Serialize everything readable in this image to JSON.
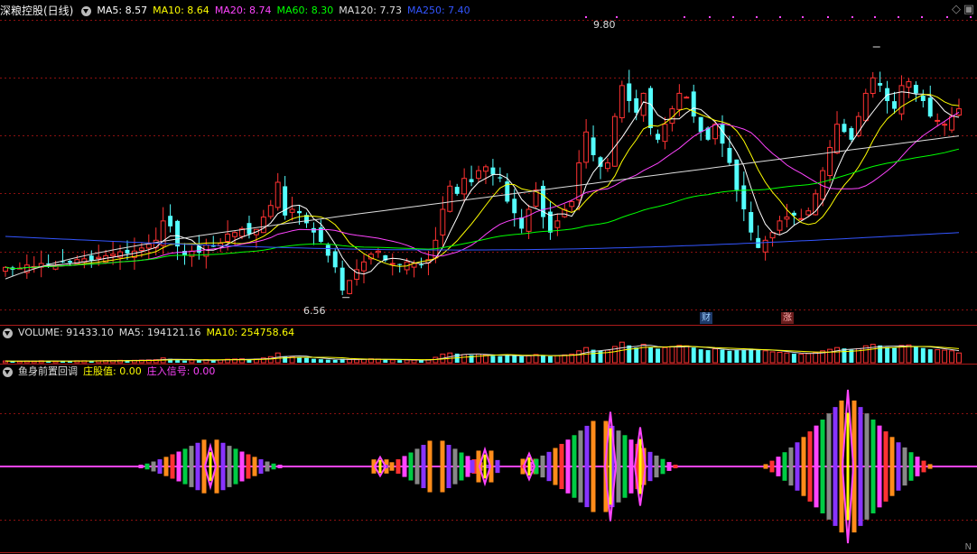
{
  "header": {
    "title": "深粮控股(日线)",
    "ma": [
      {
        "label": "MA5: 8.57",
        "color": "#ffffff"
      },
      {
        "label": "MA10: 8.64",
        "color": "#ffff00"
      },
      {
        "label": "MA20: 8.74",
        "color": "#ff44ff"
      },
      {
        "label": "MA60: 8.30",
        "color": "#00ff00"
      },
      {
        "label": "MA120: 7.73",
        "color": "#dddddd"
      },
      {
        "label": "MA250: 7.40",
        "color": "#3355ff"
      }
    ]
  },
  "volume_header": {
    "label": "VOLUME: 91433.10",
    "ma5": "MA5: 194121.16",
    "ma10": "MA10: 254758.64"
  },
  "indicator_header": {
    "name": "鱼身前置回调",
    "v1": "庄股值: 0.00",
    "v2": "庄入信号: 0.00"
  },
  "annotations": {
    "high": "9.80",
    "low": "6.56",
    "flag1": "财",
    "flag2": "涨",
    "corner": "N"
  },
  "colors": {
    "up": "#ff3232",
    "down": "#54ffff",
    "ma5": "#ffffff",
    "ma10": "#ffff00",
    "ma20": "#ff44ff",
    "ma60": "#00ff00",
    "ma120": "#dddddd",
    "ma250": "#3355ff",
    "grid": "#8a1010"
  },
  "chart_data": [
    {
      "type": "candlestick",
      "ylim": [
        6.3,
        10.15
      ],
      "high_marker": 9.8,
      "low_marker": 6.56,
      "close": [
        6.95,
        6.92,
        6.94,
        6.98,
        6.96,
        7.0,
        6.99,
        6.97,
        7.02,
        7.01,
        7.05,
        7.06,
        7.04,
        7.08,
        7.1,
        7.12,
        7.15,
        7.13,
        7.16,
        7.2,
        7.25,
        7.3,
        7.55,
        7.48,
        7.22,
        7.1,
        7.16,
        7.14,
        7.24,
        7.22,
        7.26,
        7.38,
        7.4,
        7.45,
        7.38,
        7.44,
        7.6,
        7.75,
        8.05,
        7.62,
        7.7,
        7.65,
        7.52,
        7.4,
        7.28,
        7.1,
        6.95,
        6.65,
        6.78,
        6.92,
        7.02,
        7.12,
        7.16,
        7.04,
        7.0,
        6.98,
        7.02,
        7.0,
        6.98,
        7.05,
        7.3,
        7.7,
        8.0,
        7.9,
        8.1,
        8.05,
        8.2,
        8.25,
        8.15,
        8.1,
        7.8,
        7.65,
        7.45,
        7.7,
        7.95,
        7.6,
        7.4,
        7.55,
        7.7,
        7.8,
        8.3,
        8.7,
        8.4,
        8.25,
        8.3,
        8.9,
        9.3,
        9.1,
        8.95,
        9.2,
        8.75,
        8.6,
        8.8,
        9.0,
        9.2,
        9.15,
        8.9,
        8.7,
        8.6,
        8.8,
        8.55,
        8.3,
        7.95,
        7.7,
        7.4,
        7.2,
        7.3,
        7.4,
        7.55,
        7.6,
        7.62,
        7.58,
        7.68,
        7.9,
        8.2,
        8.5,
        8.8,
        8.7,
        8.6,
        8.9,
        9.2,
        9.4,
        9.3,
        9.1,
        9.0,
        9.3,
        9.35,
        9.2,
        9.1,
        8.9,
        8.85,
        8.8,
        8.9,
        9.0
      ],
      "volume": [
        0.08,
        0.07,
        0.07,
        0.08,
        0.07,
        0.09,
        0.08,
        0.07,
        0.08,
        0.08,
        0.09,
        0.09,
        0.08,
        0.09,
        0.1,
        0.1,
        0.11,
        0.1,
        0.11,
        0.12,
        0.13,
        0.14,
        0.22,
        0.18,
        0.12,
        0.1,
        0.12,
        0.11,
        0.14,
        0.12,
        0.13,
        0.16,
        0.17,
        0.18,
        0.15,
        0.17,
        0.22,
        0.28,
        0.45,
        0.3,
        0.28,
        0.25,
        0.22,
        0.18,
        0.16,
        0.14,
        0.13,
        0.18,
        0.15,
        0.14,
        0.16,
        0.18,
        0.17,
        0.14,
        0.13,
        0.12,
        0.13,
        0.12,
        0.12,
        0.14,
        0.25,
        0.4,
        0.45,
        0.42,
        0.38,
        0.35,
        0.4,
        0.36,
        0.32,
        0.3,
        0.35,
        0.33,
        0.3,
        0.32,
        0.38,
        0.34,
        0.3,
        0.33,
        0.36,
        0.4,
        0.55,
        0.7,
        0.6,
        0.55,
        0.58,
        0.75,
        0.95,
        0.8,
        0.7,
        0.85,
        0.72,
        0.65,
        0.7,
        0.75,
        0.8,
        0.78,
        0.7,
        0.62,
        0.58,
        0.64,
        0.6,
        0.55,
        0.58,
        0.6,
        0.65,
        0.62,
        0.55,
        0.5,
        0.48,
        0.45,
        0.42,
        0.4,
        0.42,
        0.48,
        0.55,
        0.62,
        0.7,
        0.66,
        0.6,
        0.65,
        0.78,
        0.85,
        0.8,
        0.72,
        0.68,
        0.8,
        0.82,
        0.74,
        0.68,
        0.62,
        0.6,
        0.58,
        0.55,
        0.45
      ]
    },
    {
      "type": "bar",
      "clusters": [
        {
          "center": 233,
          "halfwidth": 78,
          "amp": 0.95
        },
        {
          "center": 421,
          "halfwidth": 10,
          "amp": 0.55
        },
        {
          "center": 483,
          "halfwidth": 56,
          "amp": 0.95
        },
        {
          "center": 537,
          "halfwidth": 16,
          "amp": 0.85
        },
        {
          "center": 586,
          "halfwidth": 12,
          "amp": 0.6
        },
        {
          "center": 664,
          "halfwidth": 88,
          "amp": 1.6
        },
        {
          "center": 939,
          "halfwidth": 95,
          "amp": 2.3
        }
      ],
      "spikes": [
        {
          "x": 233,
          "amp": 0.48
        },
        {
          "x": 421,
          "amp": 0.22
        },
        {
          "x": 537,
          "amp": 0.4
        },
        {
          "x": 586,
          "amp": 0.3
        },
        {
          "x": 676,
          "amp": 1.28
        },
        {
          "x": 709,
          "amp": 0.92
        },
        {
          "x": 939,
          "amp": 1.8
        }
      ]
    }
  ]
}
